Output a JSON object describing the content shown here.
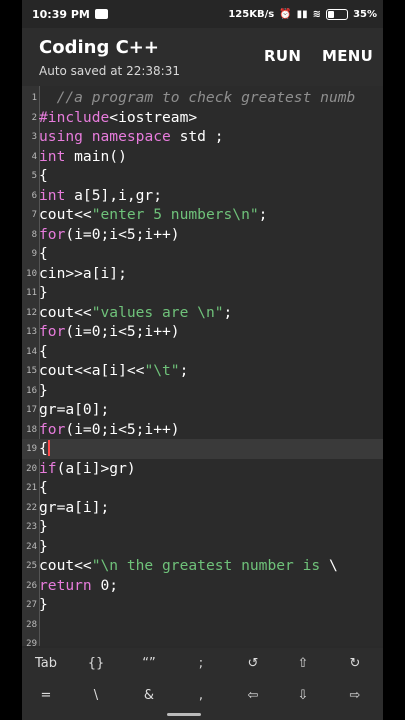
{
  "status": {
    "time": "10:39 PM",
    "speed": "125KB/s",
    "battery": "35%",
    "battery_level": 0.35
  },
  "app": {
    "title": "Coding C++",
    "subtitle": "Auto saved at 22:38:31",
    "run_label": "RUN",
    "menu_label": "MENU"
  },
  "editor": {
    "lines": [
      {
        "n": "1",
        "t": "  //a program to check greatest numb"
      },
      {
        "n": "2",
        "t": "#include<iostream>"
      },
      {
        "n": "3",
        "t": "using namespace std ;"
      },
      {
        "n": "4",
        "t": "int main()"
      },
      {
        "n": "5",
        "t": "{"
      },
      {
        "n": "6",
        "t": "int a[5],i,gr;"
      },
      {
        "n": "7",
        "t": "cout<<\"enter 5 numbers\\n\";"
      },
      {
        "n": "8",
        "t": "for(i=0;i<5;i++)"
      },
      {
        "n": "9",
        "t": "{"
      },
      {
        "n": "10",
        "t": "cin>>a[i];"
      },
      {
        "n": "11",
        "t": "}"
      },
      {
        "n": "12",
        "t": "cout<<\"values are \\n\";"
      },
      {
        "n": "13",
        "t": "for(i=0;i<5;i++)"
      },
      {
        "n": "14",
        "t": "{"
      },
      {
        "n": "15",
        "t": "cout<<a[i]<<\"\\t\";"
      },
      {
        "n": "16",
        "t": "}"
      },
      {
        "n": "17",
        "t": "gr=a[0];"
      },
      {
        "n": "18",
        "t": "for(i=0;i<5;i++)"
      },
      {
        "n": "19",
        "t": "{"
      },
      {
        "n": "20",
        "t": "if(a[i]>gr)"
      },
      {
        "n": "21",
        "t": "{"
      },
      {
        "n": "22",
        "t": "gr=a[i];"
      },
      {
        "n": "23",
        "t": "}"
      },
      {
        "n": "24",
        "t": "}"
      },
      {
        "n": "25",
        "t": "cout<<\"\\n the greatest number is \\"
      },
      {
        "n": "26",
        "t": "return 0;"
      },
      {
        "n": "27",
        "t": "}"
      },
      {
        "n": "28",
        "t": ""
      },
      {
        "n": "29",
        "t": ""
      }
    ],
    "active_line": "19"
  },
  "keys": {
    "row1": [
      "Tab",
      "{}",
      "“”",
      ";",
      "↺",
      "⇧",
      "↻"
    ],
    "row2": [
      "=",
      "\\",
      "&",
      ",",
      "⇦",
      "⇩",
      "⇨"
    ]
  }
}
